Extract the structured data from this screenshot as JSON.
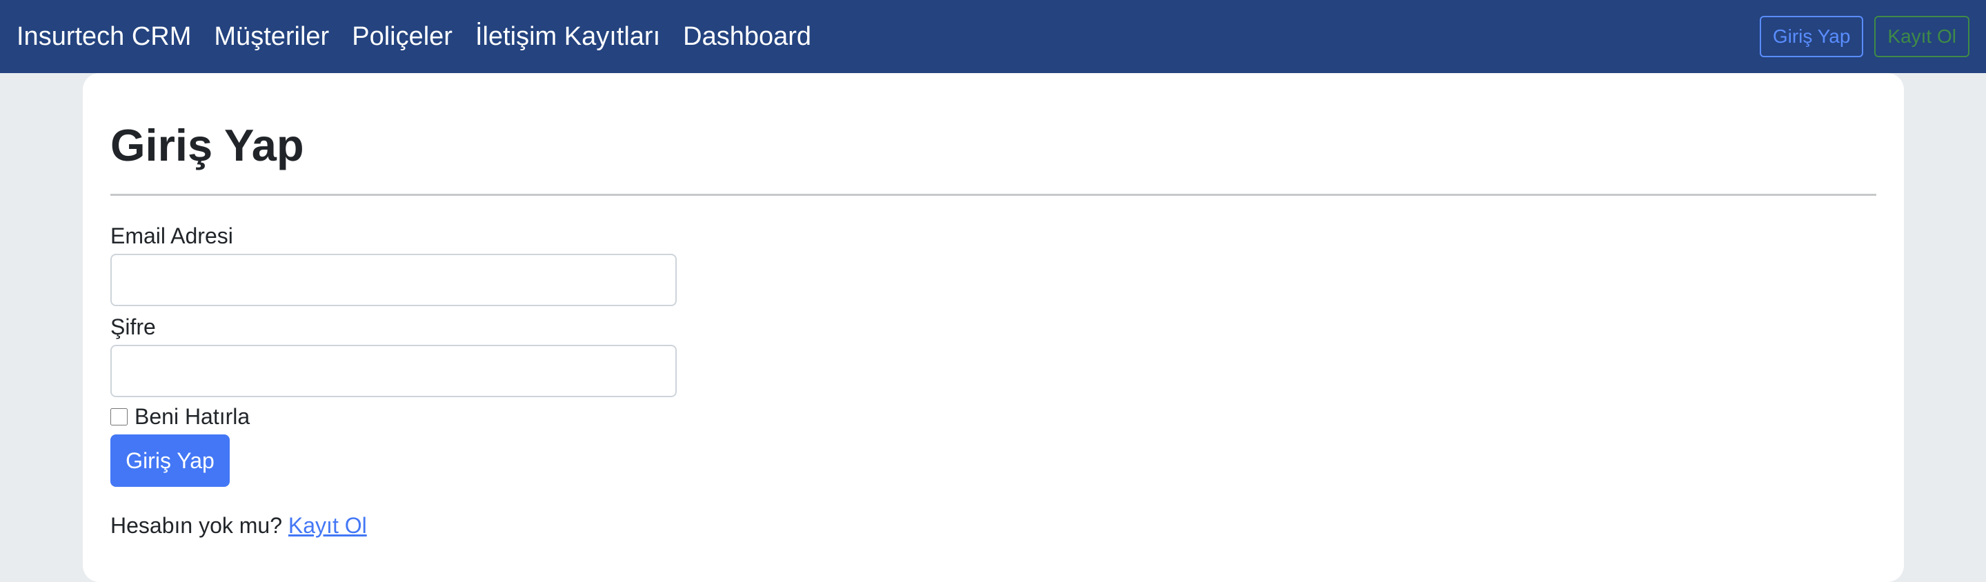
{
  "navbar": {
    "brand": "Insurtech CRM",
    "links": [
      {
        "label": "Müşteriler"
      },
      {
        "label": "Poliçeler"
      },
      {
        "label": "İletişim Kayıtları"
      },
      {
        "label": "Dashboard"
      }
    ],
    "login_button": "Giriş Yap",
    "register_button": "Kayıt Ol"
  },
  "login_form": {
    "title": "Giriş Yap",
    "email_label": "Email Adresi",
    "email_value": "",
    "password_label": "Şifre",
    "password_value": "",
    "remember_label": "Beni Hatırla",
    "remember_checked": false,
    "submit_label": "Giriş Yap",
    "no_account_text": "Hesabın yok mu?",
    "register_link": "Kayıt Ol"
  },
  "colors": {
    "navbar_bg": "#24437f",
    "page_bg": "#e9ecef",
    "primary": "#4377f5",
    "success_outline": "#3f8a47"
  }
}
